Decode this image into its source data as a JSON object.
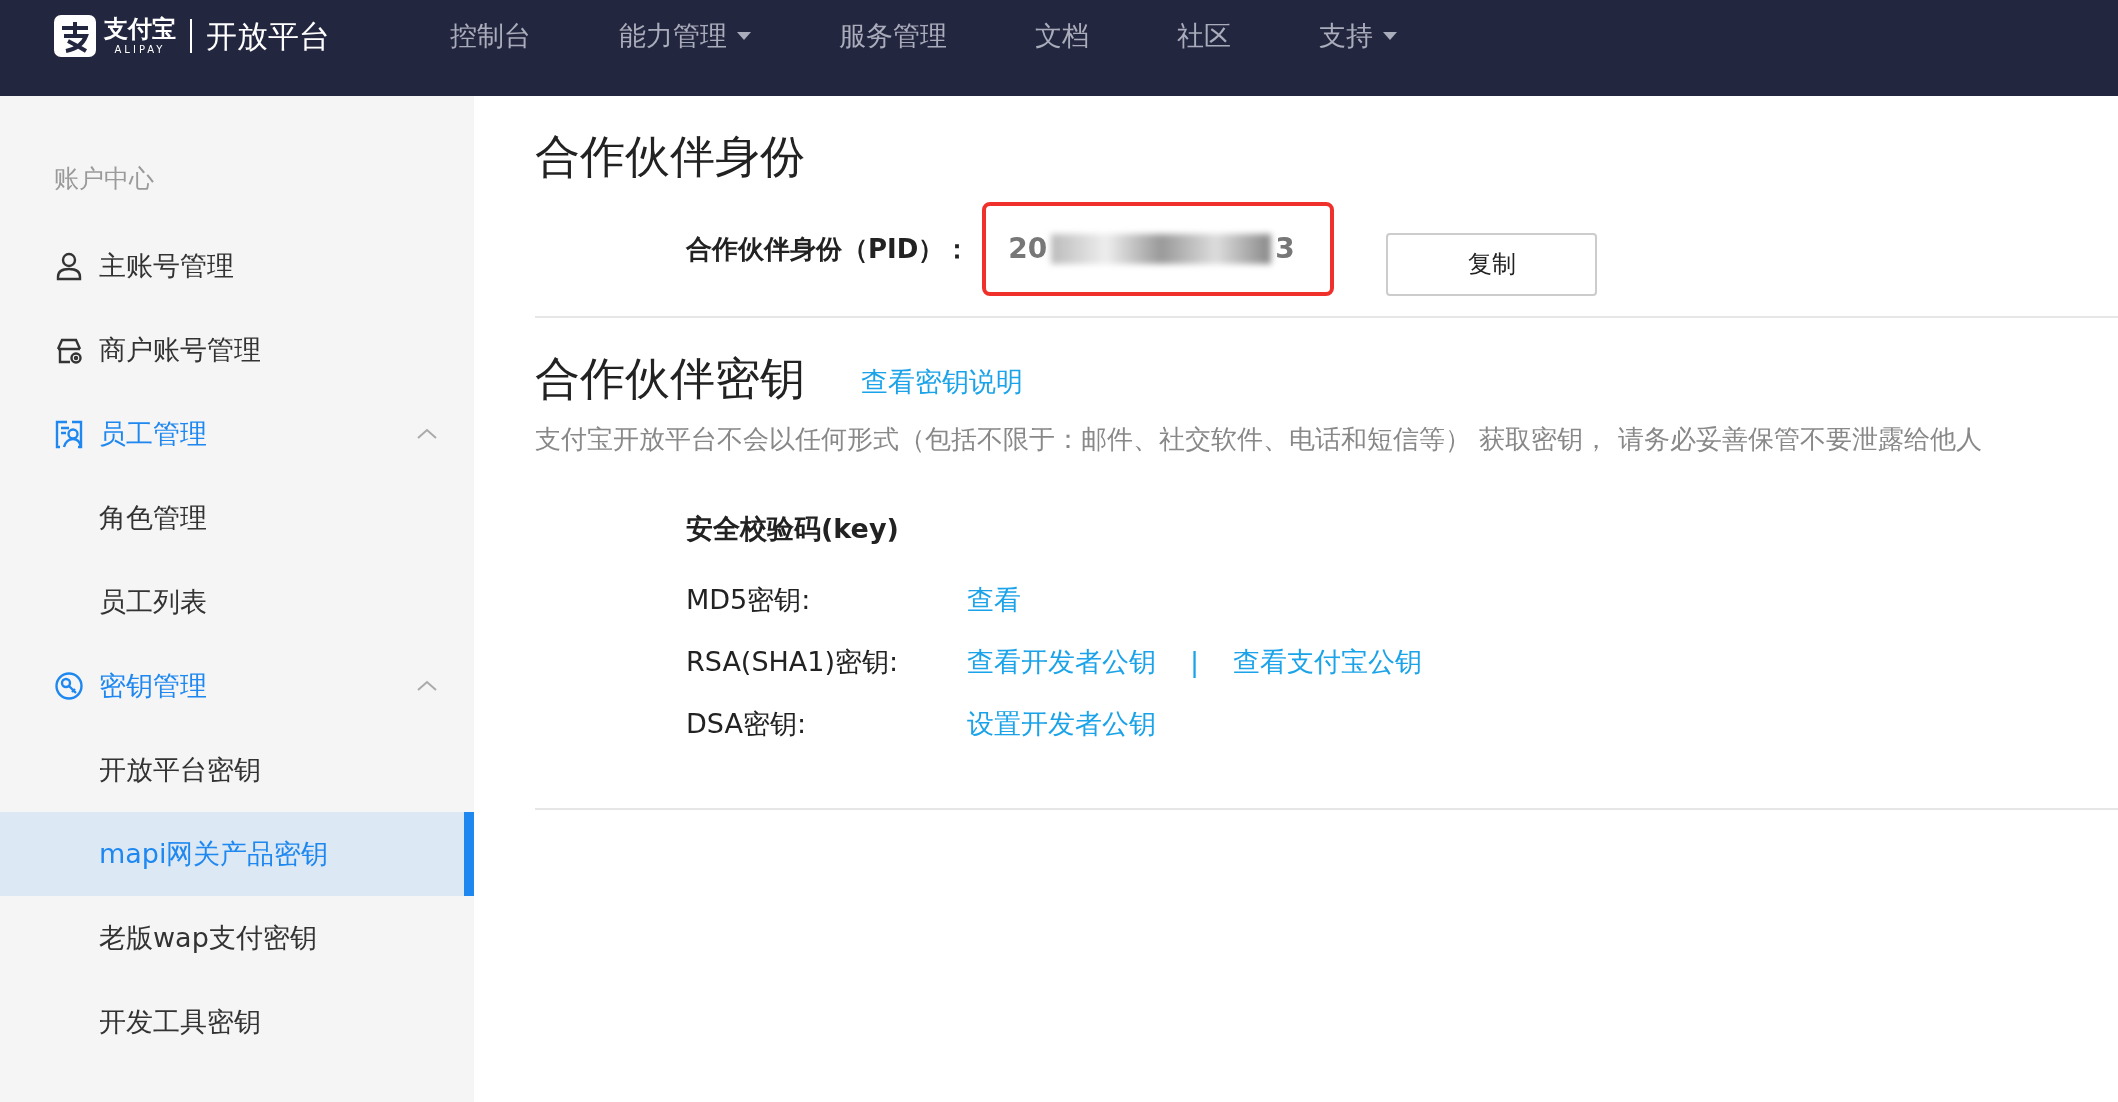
{
  "header": {
    "logo_text": "支付宝",
    "logo_subtext": "ALIPAY",
    "platform_title": "开放平台",
    "nav": [
      {
        "label": "控制台",
        "dropdown": false
      },
      {
        "label": "能力管理",
        "dropdown": true
      },
      {
        "label": "服务管理",
        "dropdown": false
      },
      {
        "label": "文档",
        "dropdown": false
      },
      {
        "label": "社区",
        "dropdown": false
      },
      {
        "label": "支持",
        "dropdown": true
      }
    ]
  },
  "sidebar": {
    "heading": "账户中心",
    "items": [
      {
        "label": "主账号管理",
        "kind": "person"
      },
      {
        "label": "商户账号管理",
        "kind": "shop"
      },
      {
        "label": "员工管理",
        "kind": "staff",
        "expanded": true,
        "children": [
          {
            "label": "角色管理",
            "selected": false
          },
          {
            "label": "员工列表",
            "selected": false
          }
        ]
      },
      {
        "label": "密钥管理",
        "kind": "key",
        "expanded": true,
        "children": [
          {
            "label": "开放平台密钥",
            "selected": false
          },
          {
            "label": "mapi网关产品密钥",
            "selected": true
          },
          {
            "label": "老版wap支付密钥",
            "selected": false
          },
          {
            "label": "开发工具密钥",
            "selected": false
          }
        ]
      }
    ]
  },
  "partner_identity": {
    "title": "合作伙伴身份",
    "pid_label": "合作伙伴身份（PID）：",
    "pid_value_start": "20",
    "pid_value_end": "3",
    "highlighted": true,
    "copy_button": "复制"
  },
  "partner_key": {
    "title": "合作伙伴密钥",
    "help_link": "查看密钥说明",
    "description": "支付宝开放平台不会以任何形式（包括不限于：邮件、社交软件、电话和短信等） 获取密钥， 请务必妥善保管不要泄露给他人",
    "section_title": "安全校验码(key)",
    "rows": [
      {
        "label": "MD5密钥:",
        "links": [
          "查看"
        ]
      },
      {
        "label": "RSA(SHA1)密钥:",
        "links": [
          "查看开发者公钥",
          "查看支付宝公钥"
        ],
        "separator": "|"
      },
      {
        "label": "DSA密钥:",
        "links": [
          "设置开发者公钥"
        ]
      }
    ]
  }
}
